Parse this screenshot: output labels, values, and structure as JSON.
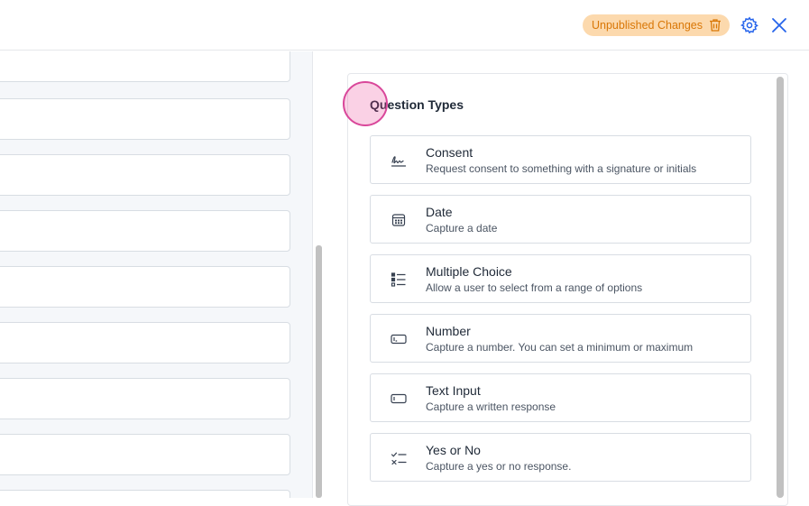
{
  "header": {
    "status_badge": "Unpublished Changes",
    "icons": {
      "badge": "trash-icon",
      "settings": "gear-icon",
      "close": "close-icon"
    },
    "colors": {
      "badge_bg": "#fcd9ad",
      "badge_text": "#d97706",
      "accent": "#2563eb"
    }
  },
  "panel": {
    "title": "Question Types",
    "question_types": [
      {
        "label": "Consent",
        "description": "Request consent to something with a signature or initials",
        "icon": "signature-icon"
      },
      {
        "label": "Date",
        "description": "Capture a date",
        "icon": "calendar-icon"
      },
      {
        "label": "Multiple Choice",
        "description": "Allow a user to select from a range of options",
        "icon": "list-icon"
      },
      {
        "label": "Number",
        "description": "Capture a number. You can set a minimum or maximum",
        "icon": "number-input-icon"
      },
      {
        "label": "Text Input",
        "description": "Capture a written response",
        "icon": "text-input-icon"
      },
      {
        "label": "Yes or No",
        "description": "Capture a yes or no response.",
        "icon": "check-x-icon"
      }
    ]
  }
}
